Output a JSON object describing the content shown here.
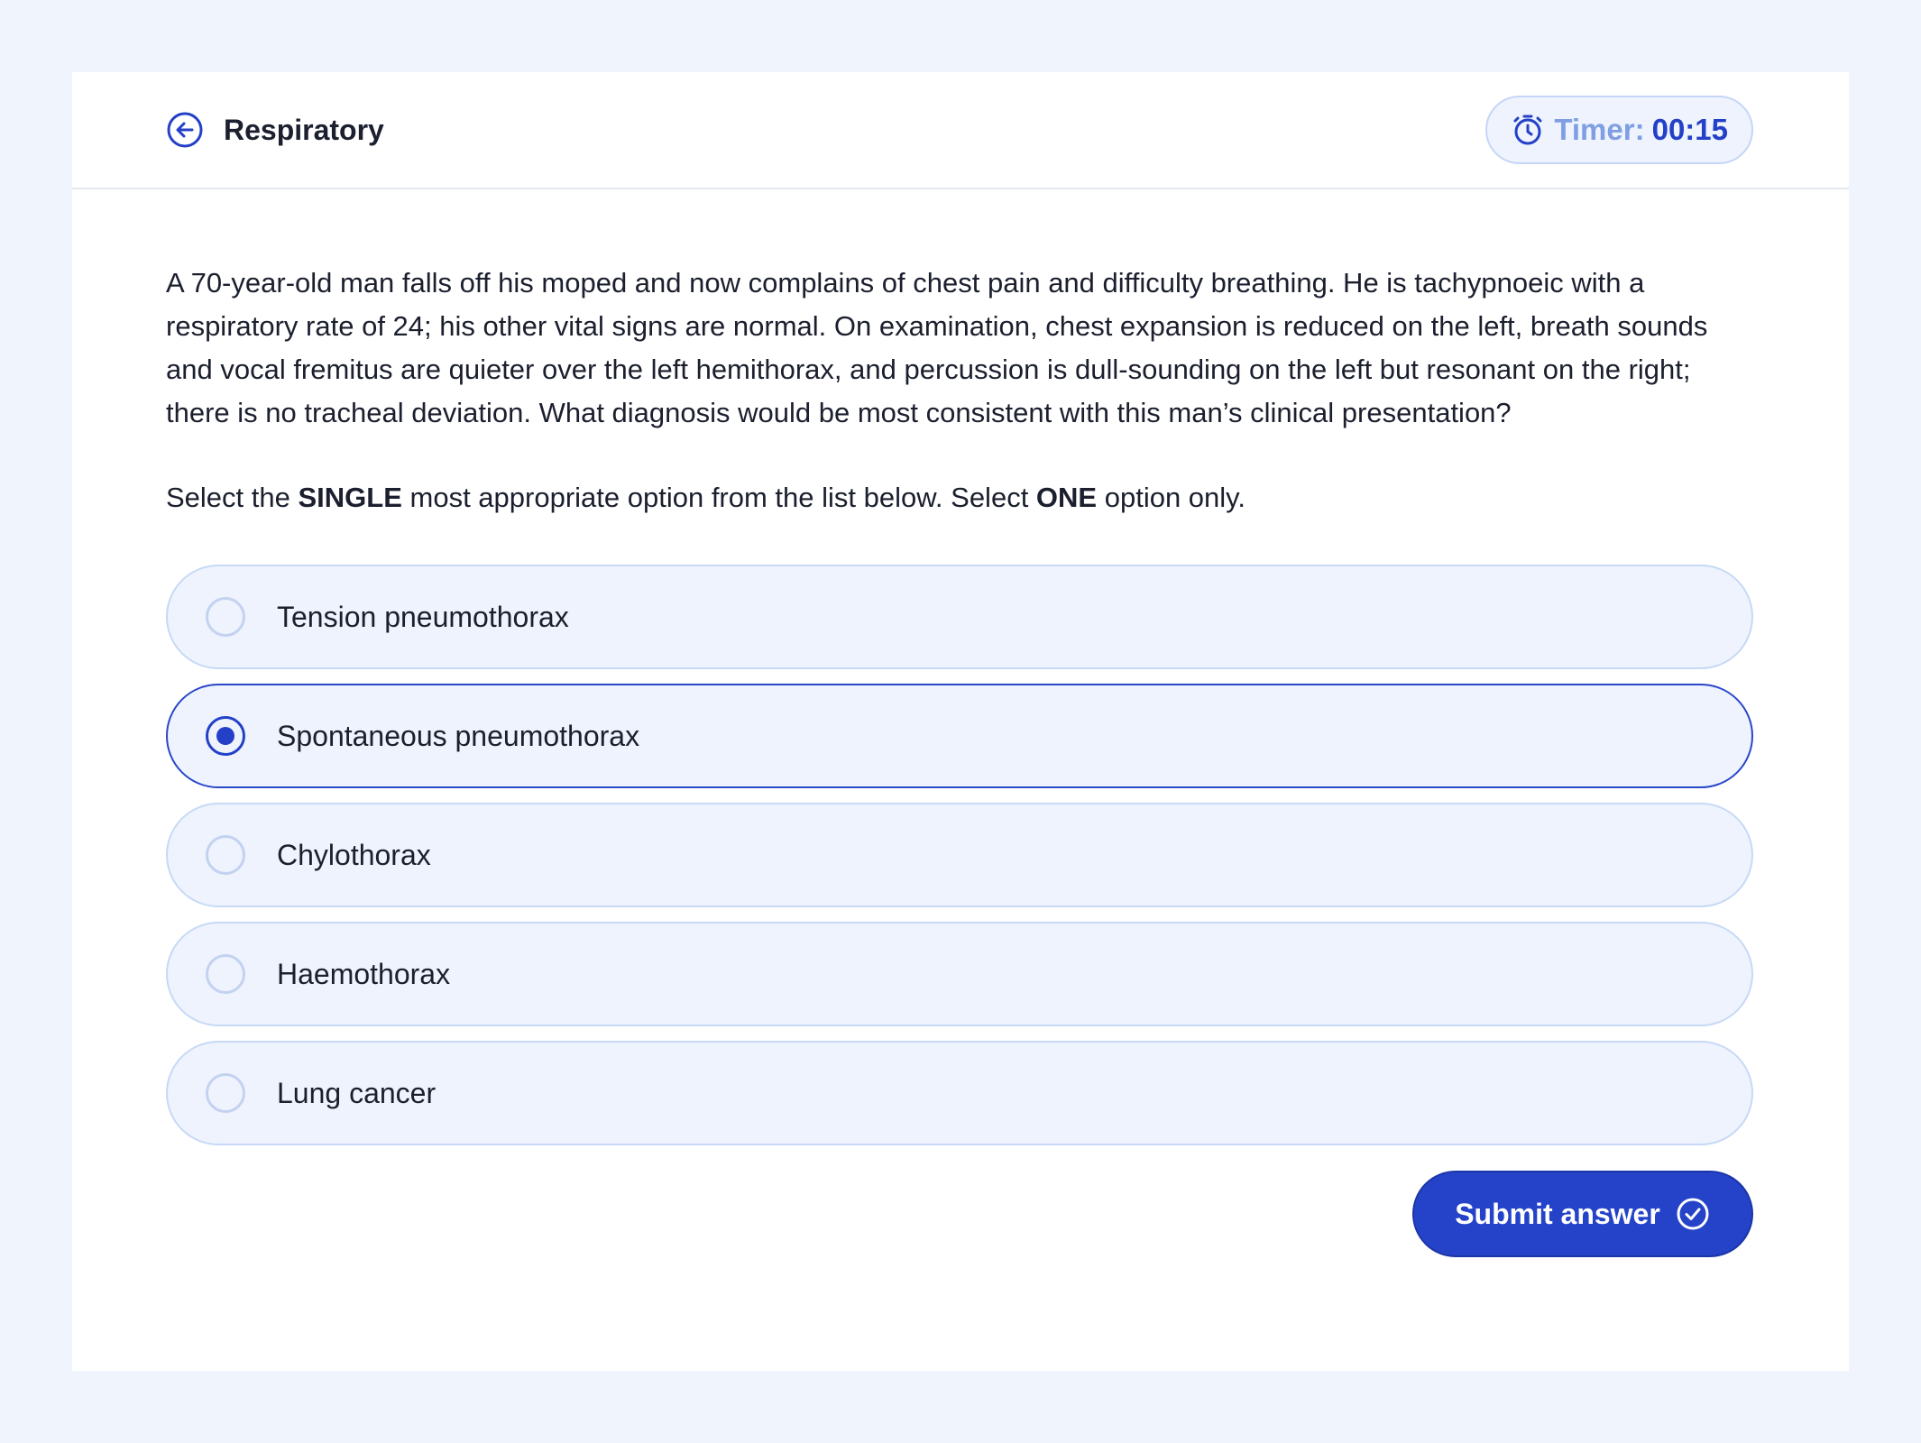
{
  "header": {
    "title": "Respiratory",
    "back_icon": "arrow-left-circle-icon",
    "timer": {
      "icon": "stopwatch-icon",
      "label": "Timer:",
      "value": "00:15"
    }
  },
  "question": {
    "text": "A 70-year-old man falls off his moped and now complains of chest pain and difficulty breathing. He is tachypnoeic with a respiratory rate of 24; his other vital signs are normal. On examination, chest expansion is reduced on the left, breath sounds and vocal fremitus are quieter over the left hemithorax, and percussion is dull-sounding on the left but resonant on the right; there is no tracheal deviation. What diagnosis would be most consistent with this man’s clinical presentation?",
    "instruction": {
      "part1": "Select the ",
      "emph1": "SINGLE",
      "part2": " most appropriate option from the list below. Select ",
      "emph2": "ONE",
      "part3": " option only."
    }
  },
  "options": [
    {
      "label": "Tension pneumothorax",
      "selected": false
    },
    {
      "label": "Spontaneous pneumothorax",
      "selected": true
    },
    {
      "label": "Chylothorax",
      "selected": false
    },
    {
      "label": "Haemothorax",
      "selected": false
    },
    {
      "label": "Lung cancer",
      "selected": false
    }
  ],
  "submit": {
    "label": "Submit answer",
    "icon": "check-circle-icon"
  },
  "colors": {
    "page_background": "#eff4fd",
    "accent": "#2443c8",
    "option_background": "#eef3fd",
    "option_border": "#c7d9f6",
    "timer_label": "#7f9ee4"
  }
}
